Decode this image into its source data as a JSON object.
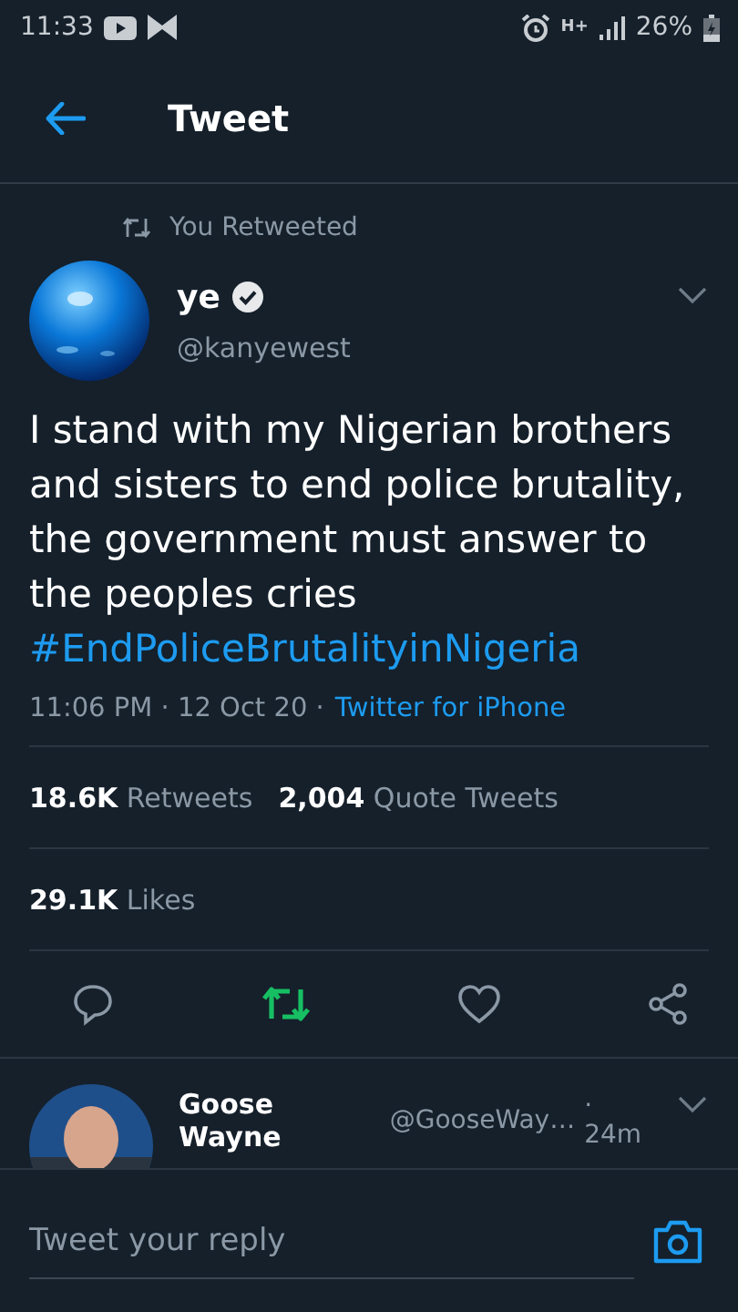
{
  "status_bar": {
    "time": "11:33",
    "network_type": "H+",
    "battery": "26%"
  },
  "header": {
    "title": "Tweet"
  },
  "retweet_note": "You Retweeted",
  "tweet": {
    "name": "ye",
    "verified": true,
    "handle": "@kanyewest",
    "text": "I stand with my Nigerian brothers and sisters to end police brutality, the government must answer to the peoples cries",
    "hashtag": "#EndPoliceBrutalityinNigeria",
    "meta": "11:06 PM · 12 Oct 20 ·",
    "source": "Twitter for iPhone",
    "stats": [
      {
        "text": "**18.6K** Retweets"
      },
      {
        "text": "**2,004** Quote Tweets"
      }
    ],
    "likes": "**29.1K** Likes",
    "retweeted": true,
    "liked": false
  },
  "reply": {
    "name": "Goose Wayne",
    "handle": "@GooseWay…",
    "time": "· 24m"
  },
  "composer": {
    "placeholder": "Tweet your reply"
  }
}
